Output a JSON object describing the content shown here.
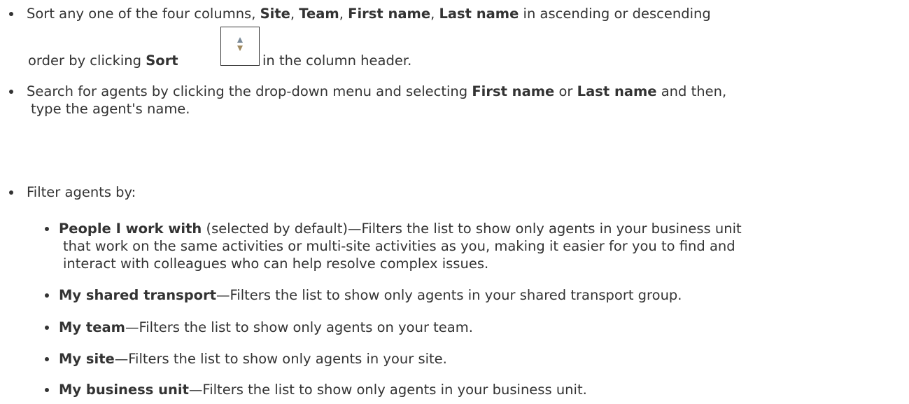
{
  "sort_item": {
    "line1": {
      "t1": "Sort any one of the four columns, ",
      "site": "Site",
      "c1": ", ",
      "team": "Team",
      "c2": ", ",
      "first_name": "First name",
      "c3": ", ",
      "last_name": "Last name",
      "t2": " in ascending or descending"
    },
    "line2": {
      "t1": "order by clicking ",
      "sort": "Sort",
      "t2": " in the column header."
    },
    "sort_icon": "sort-arrows-icon"
  },
  "search_item": {
    "line1": {
      "t1": "Search for agents by clicking the drop-down menu and selecting ",
      "first_name": "First name",
      "or": " or ",
      "last_name": "Last name",
      "t2": " and then,"
    },
    "line2": "type the agent's name."
  },
  "filter_item": {
    "intro": "Filter agents by:",
    "options": [
      {
        "name": "People I work with",
        "lines": [
          " (selected by default)—Filters the list to show only agents in your business unit",
          "that work on the same activities or multi-site activities as you, making it easier for you to find and",
          "interact with colleagues who can help resolve complex issues."
        ]
      },
      {
        "name": "My shared transport",
        "lines": [
          "—Filters the list to show only agents in your shared transport group."
        ]
      },
      {
        "name": "My team",
        "lines": [
          "—Filters the list to show only agents on your team."
        ]
      },
      {
        "name": "My site",
        "lines": [
          "—Filters the list to show only agents in your site."
        ]
      },
      {
        "name": "My business unit",
        "lines": [
          "—Filters the list to show only agents in your business unit."
        ]
      }
    ]
  },
  "colors": {
    "text": "#333333",
    "icon_up": "#7a8a99",
    "icon_down": "#a08a60"
  }
}
